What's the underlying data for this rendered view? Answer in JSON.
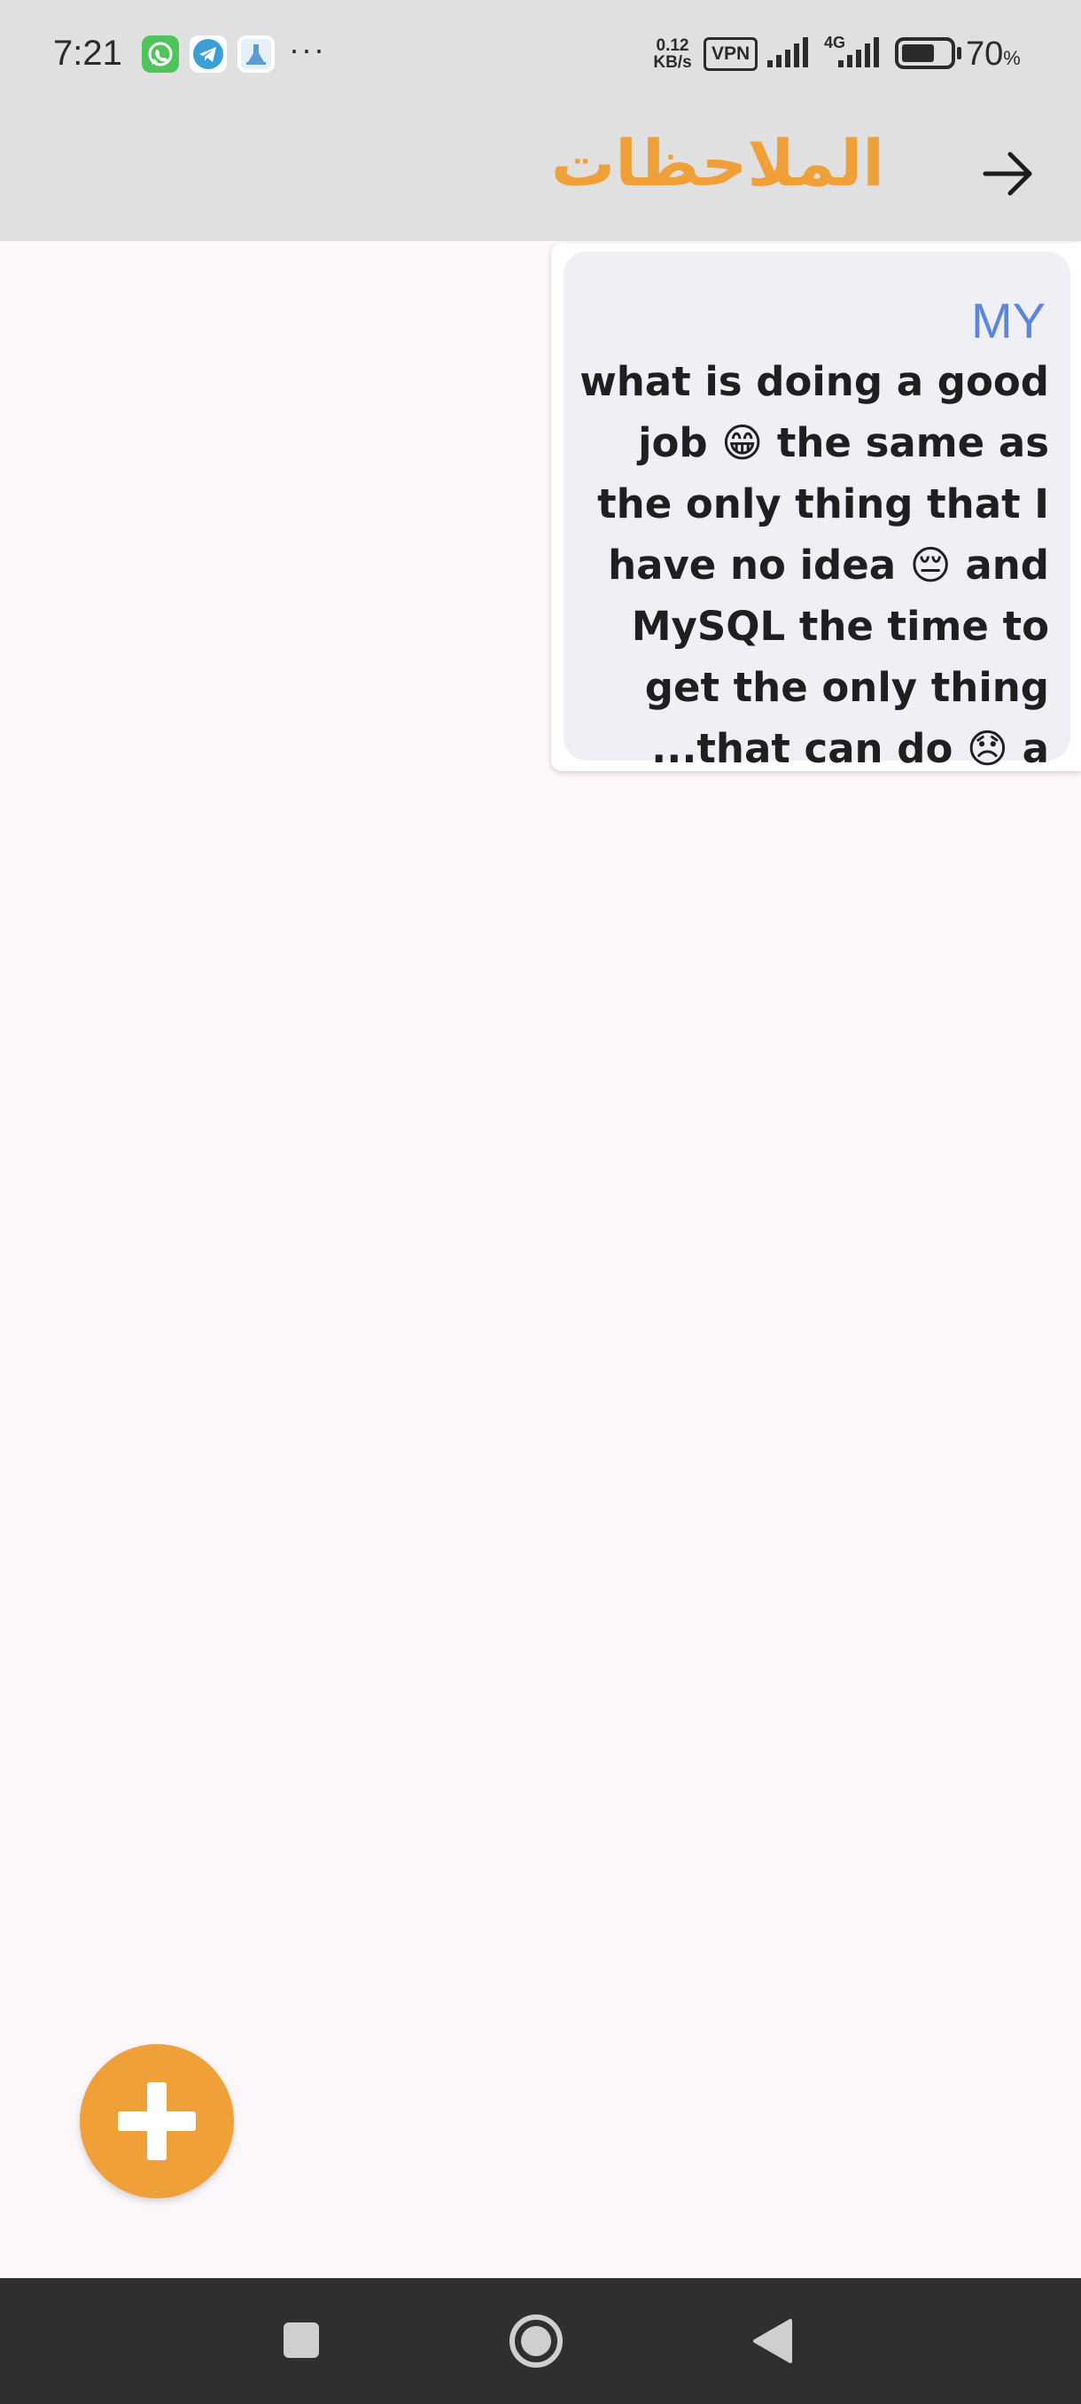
{
  "status_bar": {
    "time": "7:21",
    "notification_icons": [
      "whatsapp-icon",
      "telegram-icon",
      "app-notification-icon"
    ],
    "more": "···",
    "net_speed_value": "0.12",
    "net_speed_unit": "KB/s",
    "vpn": "VPN",
    "network_type": "4G",
    "battery_percent": "70",
    "battery_unit": "%",
    "battery_level": 0.7
  },
  "app_bar": {
    "title": "الملاحظات",
    "back_icon": "arrow-right-icon"
  },
  "notes": [
    {
      "title": "MY",
      "body": "what is doing a good job 😁 the same as the only thing that I have no idea 😔 and MySQL the time to get the only thing that can do 😞 a..."
    }
  ],
  "fab": {
    "icon": "plus-icon"
  },
  "nav_bar": {
    "icons": [
      "recents-square-icon",
      "home-circle-icon",
      "back-triangle-icon"
    ]
  },
  "colors": {
    "accent": "#f0a039",
    "note_title": "#5b86dc",
    "app_bar_bg": "#e0e0e0",
    "page_bg": "#fcf7fb",
    "card_bg": "#f1eff6",
    "nav_bar_bg": "#2f2e31"
  }
}
